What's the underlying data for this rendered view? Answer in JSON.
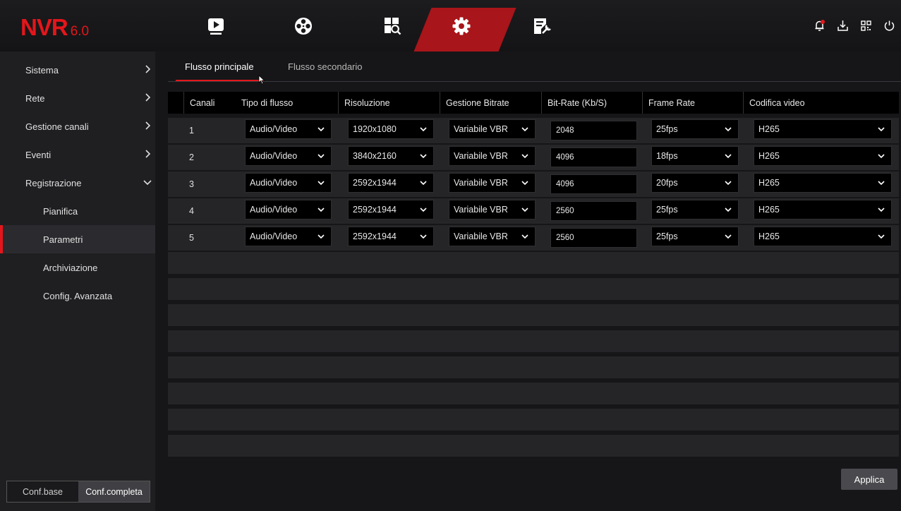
{
  "logo": {
    "main": "NVR",
    "version": "6.0"
  },
  "nav": {
    "tabs": [
      {
        "name": "live-view",
        "icon": "play-monitor-icon"
      },
      {
        "name": "playback",
        "icon": "film-reel-icon"
      },
      {
        "name": "search",
        "icon": "grid-search-icon"
      },
      {
        "name": "settings",
        "icon": "gear-icon",
        "active": true
      },
      {
        "name": "system-info",
        "icon": "document-wrench-icon"
      }
    ],
    "right_icons": [
      "bell-icon",
      "download-icon",
      "qr-code-icon",
      "power-icon"
    ]
  },
  "sidebar": {
    "items": [
      {
        "label": "Sistema",
        "chevron": "right"
      },
      {
        "label": "Rete",
        "chevron": "right"
      },
      {
        "label": "Gestione canali",
        "chevron": "right"
      },
      {
        "label": "Eventi",
        "chevron": "right"
      },
      {
        "label": "Registrazione",
        "chevron": "down"
      },
      {
        "label": "Pianifica",
        "sub": true
      },
      {
        "label": "Parametri",
        "sub": true,
        "active": true
      },
      {
        "label": "Archiviazione",
        "sub": true
      },
      {
        "label": "Config. Avanzata",
        "sub": true
      }
    ],
    "toggle": {
      "base": "Conf.base",
      "full": "Conf.completa",
      "selected": "full"
    }
  },
  "subtabs": {
    "primary": "Flusso principale",
    "secondary": "Flusso secondario",
    "active": "primary"
  },
  "table": {
    "headers": {
      "channel": "Canali",
      "stream_type": "Tipo di flusso",
      "resolution": "Risoluzione",
      "bitrate_mode": "Gestione Bitrate",
      "bitrate": "Bit-Rate (Kb/S)",
      "frame_rate": "Frame Rate",
      "codec": "Codifica video"
    },
    "rows": [
      {
        "channel": "1",
        "stream_type": "Audio/Video",
        "resolution": "1920x1080",
        "bitrate_mode": "Variabile VBR",
        "bitrate": "2048",
        "frame_rate": "25fps",
        "codec": "H265"
      },
      {
        "channel": "2",
        "stream_type": "Audio/Video",
        "resolution": "3840x2160",
        "bitrate_mode": "Variabile VBR",
        "bitrate": "4096",
        "frame_rate": "18fps",
        "codec": "H265"
      },
      {
        "channel": "3",
        "stream_type": "Audio/Video",
        "resolution": "2592x1944",
        "bitrate_mode": "Variabile VBR",
        "bitrate": "4096",
        "frame_rate": "20fps",
        "codec": "H265"
      },
      {
        "channel": "4",
        "stream_type": "Audio/Video",
        "resolution": "2592x1944",
        "bitrate_mode": "Variabile VBR",
        "bitrate": "2560",
        "frame_rate": "25fps",
        "codec": "H265"
      },
      {
        "channel": "5",
        "stream_type": "Audio/Video",
        "resolution": "2592x1944",
        "bitrate_mode": "Variabile VBR",
        "bitrate": "2560",
        "frame_rate": "25fps",
        "codec": "H265"
      }
    ]
  },
  "apply_label": "Applica",
  "colors": {
    "accent": "#e4161b",
    "active_tab_bg": "#a8151a",
    "panel": "#1f1f22",
    "row": "#252528"
  }
}
